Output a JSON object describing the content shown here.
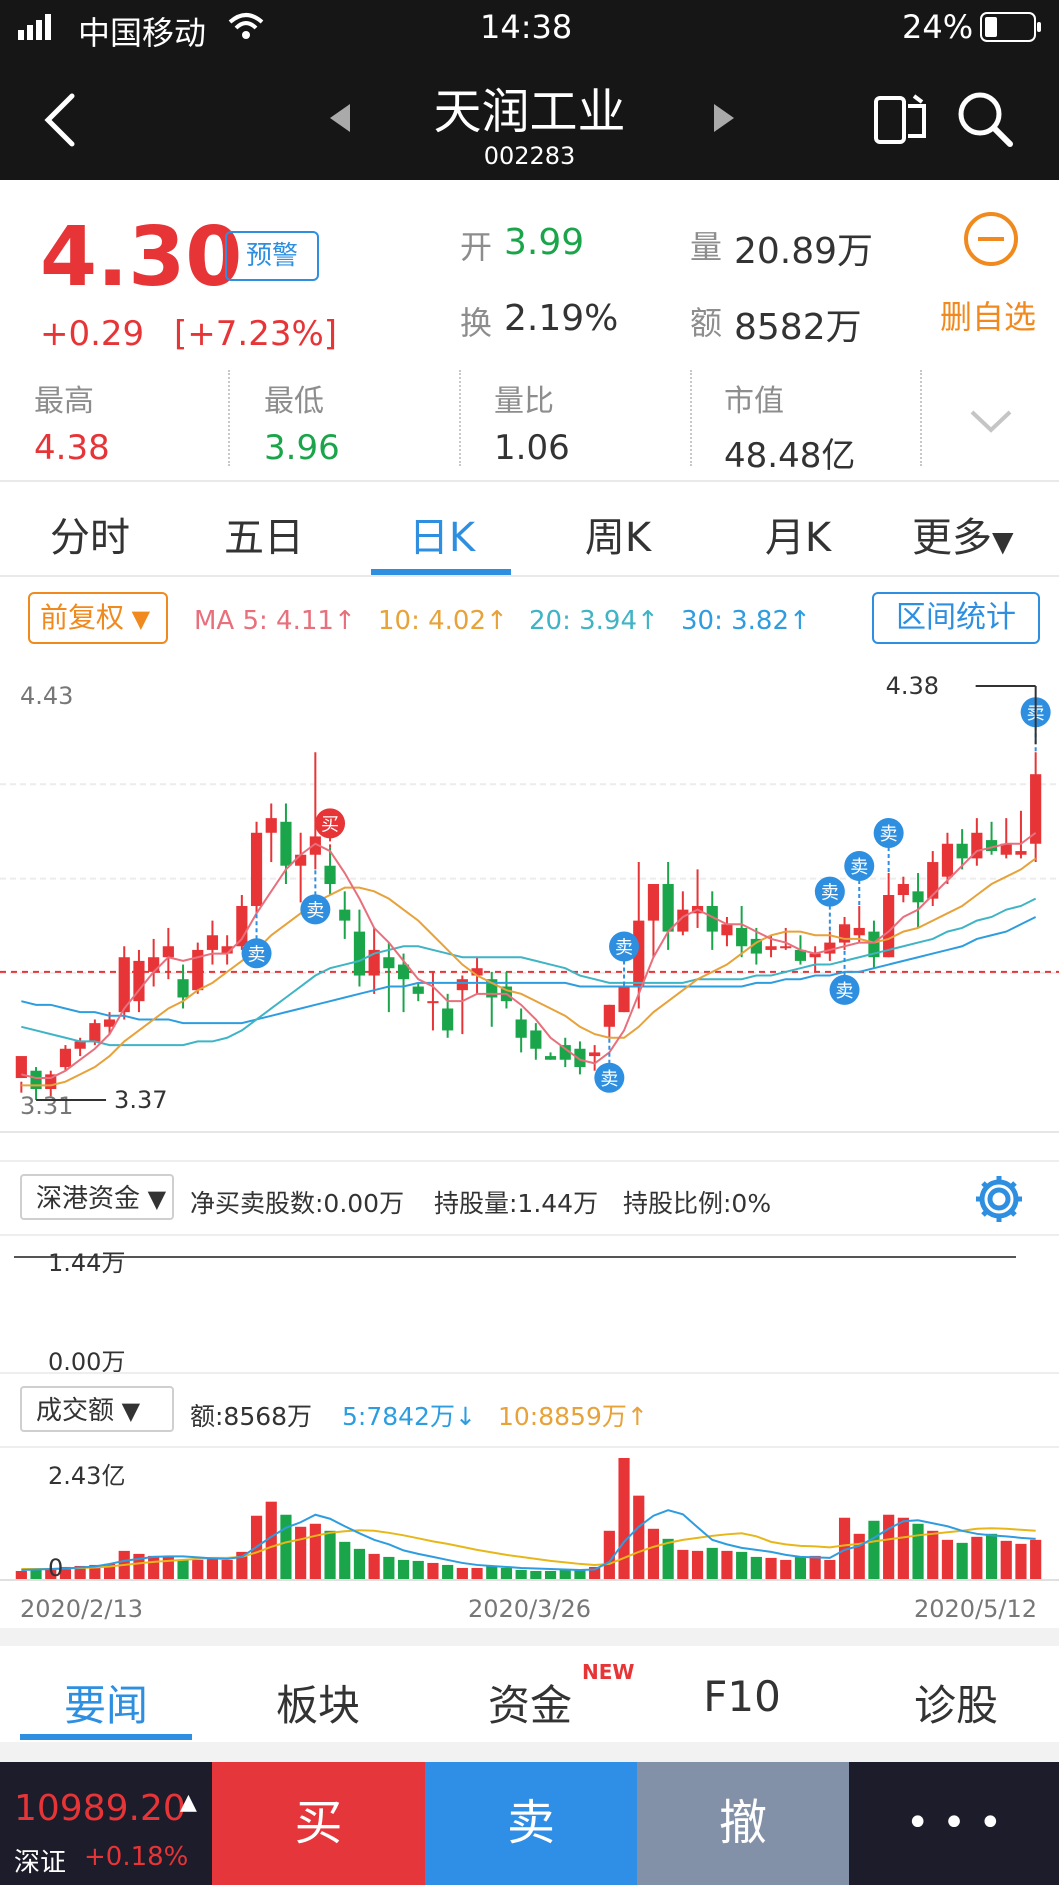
{
  "status": {
    "carrier": "中国移动",
    "time": "14:38",
    "battery": "24%"
  },
  "nav": {
    "title": "天润工业",
    "code": "002283"
  },
  "quote": {
    "price": "4.30",
    "alert_label": "预警",
    "change": "+0.29",
    "change_pct": "[+7.23%]",
    "open_label": "开",
    "open": "3.99",
    "volume_label": "量",
    "volume": "20.89万",
    "turnover_label": "换",
    "turnover": "2.19%",
    "amount_label": "额",
    "amount": "8582万",
    "remove_label": "删自选",
    "stats": [
      {
        "label": "最高",
        "value": "4.38"
      },
      {
        "label": "最低",
        "value": "3.96"
      },
      {
        "label": "量比",
        "value": "1.06"
      },
      {
        "label": "市值",
        "value": "48.48亿"
      }
    ]
  },
  "tabs": [
    "分时",
    "五日",
    "日K",
    "周K",
    "月K",
    "更多"
  ],
  "indicator": {
    "adjust_label": "前复权",
    "ma5": "MA 5: 4.11↑",
    "ma10": "10: 4.02↑",
    "ma20": "20: 3.94↑",
    "ma30": "30: 3.82↑",
    "range_button": "区间统计"
  },
  "colors": {
    "up": "#e63437",
    "down": "#1ba54a",
    "ma5": "#e86f7c",
    "ma10": "#e7a23a",
    "ma20": "#3fb4c5",
    "ma30": "#2e9de0",
    "sell_badge": "#2e8fe0",
    "buy_badge": "#e63437"
  },
  "chart_data": {
    "type": "candlestick",
    "ylim": [
      3.31,
      4.43
    ],
    "max_label": "4.38",
    "min_label": "3.37",
    "top_label": "4.43",
    "bottom_label": "3.31",
    "candles": [
      [
        3.37,
        3.43,
        3.33,
        3.36
      ],
      [
        3.39,
        3.34,
        3.31,
        3.4
      ],
      [
        3.34,
        3.38,
        3.32,
        3.39
      ],
      [
        3.4,
        3.45,
        3.39,
        3.46
      ],
      [
        3.45,
        3.47,
        3.43,
        3.48
      ],
      [
        3.47,
        3.52,
        3.46,
        3.53
      ],
      [
        3.51,
        3.53,
        3.49,
        3.55
      ],
      [
        3.55,
        3.7,
        3.53,
        3.73
      ],
      [
        3.58,
        3.69,
        3.55,
        3.72
      ],
      [
        3.66,
        3.7,
        3.62,
        3.75
      ],
      [
        3.7,
        3.73,
        3.64,
        3.78
      ],
      [
        3.64,
        3.59,
        3.56,
        3.68
      ],
      [
        3.61,
        3.72,
        3.6,
        3.74
      ],
      [
        3.72,
        3.76,
        3.68,
        3.8
      ],
      [
        3.71,
        3.73,
        3.68,
        3.76
      ],
      [
        3.73,
        3.84,
        3.72,
        3.87
      ],
      [
        3.84,
        4.04,
        3.82,
        4.07
      ],
      [
        4.04,
        4.08,
        3.96,
        4.12
      ],
      [
        4.07,
        3.95,
        3.9,
        4.12
      ],
      [
        3.95,
        3.98,
        3.85,
        4.04
      ],
      [
        3.98,
        4.03,
        3.94,
        4.26
      ],
      [
        3.95,
        3.9,
        3.87,
        4.0
      ],
      [
        3.83,
        3.8,
        3.75,
        3.88
      ],
      [
        3.77,
        3.65,
        3.62,
        3.83
      ],
      [
        3.65,
        3.72,
        3.6,
        3.78
      ],
      [
        3.7,
        3.67,
        3.55,
        3.74
      ],
      [
        3.68,
        3.64,
        3.55,
        3.71
      ],
      [
        3.62,
        3.6,
        3.58,
        3.63
      ],
      [
        3.58,
        3.58,
        3.5,
        3.66
      ],
      [
        3.56,
        3.5,
        3.48,
        3.6
      ],
      [
        3.61,
        3.64,
        3.49,
        3.65
      ],
      [
        3.65,
        3.67,
        3.6,
        3.7
      ],
      [
        3.64,
        3.59,
        3.51,
        3.66
      ],
      [
        3.62,
        3.58,
        3.56,
        3.66
      ],
      [
        3.53,
        3.48,
        3.44,
        3.56
      ],
      [
        3.5,
        3.45,
        3.42,
        3.52
      ],
      [
        3.43,
        3.42,
        3.42,
        3.44
      ],
      [
        3.46,
        3.42,
        3.4,
        3.48
      ],
      [
        3.45,
        3.4,
        3.38,
        3.47
      ],
      [
        3.43,
        3.44,
        3.39,
        3.46
      ],
      [
        3.51,
        3.57,
        3.48,
        3.57
      ],
      [
        3.55,
        3.62,
        3.55,
        3.62
      ],
      [
        3.62,
        3.8,
        3.56,
        3.96
      ],
      [
        3.8,
        3.9,
        3.7,
        3.9
      ],
      [
        3.9,
        3.77,
        3.72,
        3.96
      ],
      [
        3.77,
        3.83,
        3.76,
        3.88
      ],
      [
        3.82,
        3.84,
        3.78,
        3.94
      ],
      [
        3.84,
        3.77,
        3.72,
        3.88
      ],
      [
        3.76,
        3.79,
        3.73,
        3.81
      ],
      [
        3.78,
        3.73,
        3.7,
        3.84
      ],
      [
        3.75,
        3.71,
        3.68,
        3.78
      ],
      [
        3.72,
        3.73,
        3.7,
        3.76
      ],
      [
        3.73,
        3.73,
        3.72,
        3.78
      ],
      [
        3.72,
        3.69,
        3.68,
        3.76
      ],
      [
        3.7,
        3.71,
        3.66,
        3.73
      ],
      [
        3.71,
        3.74,
        3.69,
        3.77
      ],
      [
        3.74,
        3.79,
        3.72,
        3.81
      ],
      [
        3.76,
        3.78,
        3.74,
        3.84
      ],
      [
        3.77,
        3.7,
        3.67,
        3.8
      ],
      [
        3.7,
        3.87,
        3.7,
        3.93
      ],
      [
        3.87,
        3.9,
        3.85,
        3.92
      ],
      [
        3.88,
        3.85,
        3.78,
        3.93
      ],
      [
        3.86,
        3.96,
        3.84,
        3.99
      ],
      [
        3.92,
        4.01,
        3.9,
        4.04
      ],
      [
        4.01,
        3.97,
        3.94,
        4.05
      ],
      [
        3.97,
        4.04,
        3.95,
        4.08
      ],
      [
        4.02,
        3.99,
        3.98,
        4.07
      ],
      [
        3.98,
        4.01,
        3.97,
        4.08
      ],
      [
        3.98,
        3.99,
        3.97,
        4.1
      ],
      [
        4.01,
        4.2,
        3.96,
        4.26
      ]
    ],
    "ma5": [
      3.38,
      3.37,
      3.37,
      3.39,
      3.42,
      3.45,
      3.49,
      3.56,
      3.61,
      3.66,
      3.7,
      3.69,
      3.7,
      3.71,
      3.71,
      3.75,
      3.82,
      3.88,
      3.94,
      3.98,
      4.01,
      3.99,
      3.93,
      3.86,
      3.78,
      3.74,
      3.69,
      3.64,
      3.62,
      3.58,
      3.58,
      3.6,
      3.6,
      3.6,
      3.57,
      3.53,
      3.48,
      3.45,
      3.42,
      3.41,
      3.44,
      3.5,
      3.6,
      3.7,
      3.77,
      3.81,
      3.83,
      3.81,
      3.79,
      3.79,
      3.77,
      3.75,
      3.74,
      3.72,
      3.71,
      3.72,
      3.73,
      3.74,
      3.74,
      3.77,
      3.81,
      3.83,
      3.87,
      3.91,
      3.95,
      3.99,
      4.0,
      4.01,
      4.01,
      4.04
    ],
    "ma10": [
      3.35,
      3.35,
      3.35,
      3.36,
      3.38,
      3.4,
      3.43,
      3.47,
      3.5,
      3.53,
      3.56,
      3.58,
      3.61,
      3.63,
      3.66,
      3.69,
      3.72,
      3.76,
      3.79,
      3.82,
      3.85,
      3.87,
      3.89,
      3.89,
      3.88,
      3.86,
      3.83,
      3.8,
      3.76,
      3.72,
      3.68,
      3.65,
      3.63,
      3.61,
      3.6,
      3.58,
      3.56,
      3.54,
      3.51,
      3.49,
      3.48,
      3.48,
      3.51,
      3.55,
      3.58,
      3.61,
      3.64,
      3.66,
      3.68,
      3.71,
      3.74,
      3.76,
      3.77,
      3.77,
      3.76,
      3.76,
      3.75,
      3.75,
      3.74,
      3.75,
      3.77,
      3.78,
      3.8,
      3.82,
      3.84,
      3.87,
      3.9,
      3.92,
      3.94,
      3.97
    ],
    "ma20": [
      3.51,
      3.5,
      3.49,
      3.48,
      3.47,
      3.47,
      3.46,
      3.46,
      3.46,
      3.46,
      3.46,
      3.46,
      3.47,
      3.47,
      3.48,
      3.5,
      3.53,
      3.56,
      3.59,
      3.62,
      3.65,
      3.67,
      3.68,
      3.69,
      3.71,
      3.72,
      3.73,
      3.73,
      3.72,
      3.71,
      3.7,
      3.7,
      3.7,
      3.7,
      3.7,
      3.69,
      3.68,
      3.67,
      3.65,
      3.64,
      3.63,
      3.63,
      3.63,
      3.63,
      3.63,
      3.63,
      3.64,
      3.64,
      3.64,
      3.64,
      3.65,
      3.65,
      3.66,
      3.67,
      3.68,
      3.68,
      3.69,
      3.7,
      3.71,
      3.72,
      3.73,
      3.74,
      3.75,
      3.77,
      3.78,
      3.8,
      3.81,
      3.83,
      3.84,
      3.86
    ],
    "ma30": [
      3.58,
      3.57,
      3.57,
      3.56,
      3.55,
      3.55,
      3.54,
      3.54,
      3.53,
      3.53,
      3.53,
      3.52,
      3.52,
      3.52,
      3.52,
      3.52,
      3.53,
      3.54,
      3.55,
      3.56,
      3.57,
      3.58,
      3.59,
      3.6,
      3.61,
      3.62,
      3.62,
      3.63,
      3.63,
      3.63,
      3.63,
      3.63,
      3.63,
      3.63,
      3.63,
      3.63,
      3.63,
      3.63,
      3.62,
      3.62,
      3.62,
      3.62,
      3.62,
      3.62,
      3.62,
      3.62,
      3.62,
      3.62,
      3.62,
      3.62,
      3.63,
      3.63,
      3.64,
      3.64,
      3.65,
      3.65,
      3.66,
      3.66,
      3.67,
      3.68,
      3.69,
      3.7,
      3.71,
      3.72,
      3.73,
      3.75,
      3.76,
      3.77,
      3.79,
      3.81
    ],
    "signals": [
      {
        "index": 20,
        "type": "sell",
        "label": "卖"
      },
      {
        "index": 21,
        "type": "buy",
        "label": "买"
      },
      {
        "index": 16,
        "type": "sell",
        "label": "卖"
      },
      {
        "index": 41,
        "type": "sell",
        "label": "卖"
      },
      {
        "index": 40,
        "type": "sell",
        "label": "卖"
      },
      {
        "index": 56,
        "type": "sell",
        "label": "卖"
      },
      {
        "index": 57,
        "type": "sell",
        "label": "卖"
      },
      {
        "index": 55,
        "type": "sell",
        "label": "卖"
      },
      {
        "index": 59,
        "type": "sell",
        "label": "卖"
      },
      {
        "index": 69,
        "type": "sell",
        "label": "卖"
      }
    ]
  },
  "hk_panel": {
    "selector": "深港资金",
    "net": "净买卖股数:0.00万",
    "holding": "持股量:1.44万",
    "ratio": "持股比例:0%",
    "top_label": "1.44万",
    "bottom_label": "0.00万"
  },
  "amount_panel": {
    "selector": "成交额",
    "amount": "额:8568万",
    "ma5": "5:7842万↓",
    "ma10": "10:8859万↑",
    "top_label": "2.43亿",
    "zero_label": "0",
    "dates": [
      "2020/2/13",
      "2020/3/26",
      "2020/5/12"
    ],
    "volumes": [
      0.18,
      0.2,
      0.22,
      0.26,
      0.28,
      0.3,
      0.32,
      0.58,
      0.52,
      0.48,
      0.48,
      0.4,
      0.4,
      0.44,
      0.4,
      0.56,
      1.28,
      1.56,
      1.3,
      1.06,
      1.12,
      0.98,
      0.76,
      0.62,
      0.52,
      0.46,
      0.4,
      0.38,
      0.34,
      0.3,
      0.24,
      0.24,
      0.28,
      0.24,
      0.2,
      0.18,
      0.18,
      0.2,
      0.2,
      0.26,
      0.98,
      2.43,
      1.68,
      1.02,
      0.82,
      0.6,
      0.58,
      0.64,
      0.58,
      0.56,
      0.46,
      0.44,
      0.4,
      0.46,
      0.48,
      0.4,
      1.24,
      0.92,
      1.18,
      1.3,
      1.24,
      1.12,
      0.98,
      0.8,
      0.74,
      0.86,
      0.92,
      0.78,
      0.72,
      0.8
    ],
    "vol_ma5": [
      0.2,
      0.21,
      0.22,
      0.23,
      0.25,
      0.27,
      0.32,
      0.38,
      0.42,
      0.46,
      0.47,
      0.47,
      0.45,
      0.43,
      0.42,
      0.46,
      0.66,
      0.86,
      1.04,
      1.15,
      1.3,
      1.22,
      1.07,
      0.93,
      0.8,
      0.71,
      0.59,
      0.52,
      0.46,
      0.4,
      0.34,
      0.3,
      0.28,
      0.26,
      0.24,
      0.23,
      0.22,
      0.21,
      0.2,
      0.21,
      0.36,
      0.76,
      1.06,
      1.28,
      1.39,
      1.31,
      1.05,
      0.8,
      0.71,
      0.64,
      0.6,
      0.56,
      0.5,
      0.46,
      0.45,
      0.44,
      0.6,
      0.68,
      0.84,
      1.02,
      1.17,
      1.19,
      1.13,
      1.07,
      0.98,
      0.92,
      0.89,
      0.87,
      0.84,
      0.82
    ],
    "vol_ma10": [
      0.22,
      0.22,
      0.22,
      0.23,
      0.24,
      0.25,
      0.27,
      0.3,
      0.33,
      0.36,
      0.38,
      0.4,
      0.42,
      0.44,
      0.44,
      0.46,
      0.55,
      0.66,
      0.75,
      0.81,
      0.88,
      0.94,
      0.97,
      0.99,
      0.98,
      0.94,
      0.89,
      0.83,
      0.77,
      0.72,
      0.66,
      0.6,
      0.55,
      0.5,
      0.46,
      0.42,
      0.38,
      0.35,
      0.32,
      0.3,
      0.32,
      0.44,
      0.56,
      0.66,
      0.74,
      0.8,
      0.84,
      0.88,
      0.91,
      0.93,
      0.87,
      0.76,
      0.71,
      0.68,
      0.67,
      0.65,
      0.69,
      0.72,
      0.77,
      0.81,
      0.85,
      0.89,
      0.92,
      0.95,
      0.98,
      1.02,
      1.03,
      1.02,
      1.0,
      0.98
    ]
  },
  "bottom_tabs": [
    "要闻",
    "板块",
    "资金",
    "F10",
    "诊股"
  ],
  "new_badge": "NEW",
  "trade_bar": {
    "index_value": "10989.20",
    "index_name": "深证",
    "index_change": "+0.18%",
    "buy": "买",
    "sell": "卖",
    "cancel": "撤",
    "more": "• • •"
  }
}
